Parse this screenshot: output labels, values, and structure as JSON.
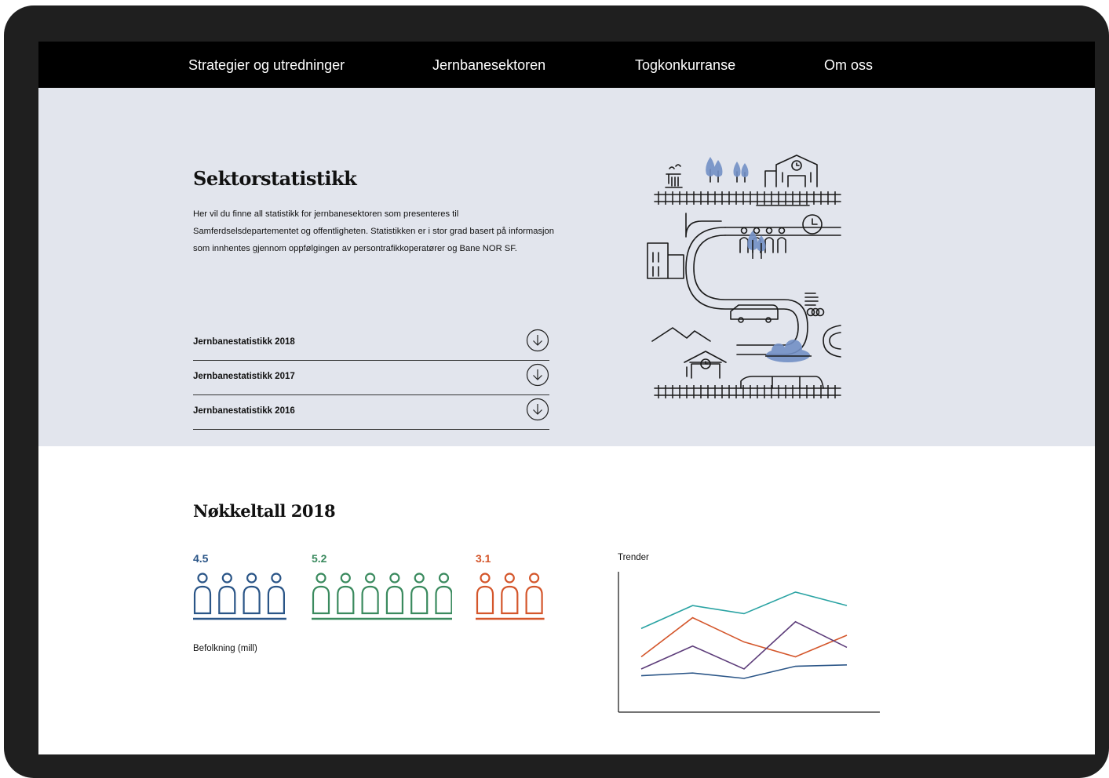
{
  "nav": {
    "items": [
      {
        "label": "Strategier og utredninger"
      },
      {
        "label": "Jernbanesektoren"
      },
      {
        "label": "Togkonkurranse"
      },
      {
        "label": "Om oss"
      }
    ]
  },
  "hero": {
    "title": "Sektorstatistikk",
    "text": "Her vil du finne all statistikk for jernbanesektoren som presenteres til Samferdselsdepartementet og offentligheten. Statistikken er i stor grad basert på informasjon som innhentes gjennom oppfølgingen av persontrafikkoperatører og Bane NOR SF.",
    "downloads": [
      {
        "label": "Jernbanestatistikk 2018",
        "icon": "download-circle-icon"
      },
      {
        "label": "Jernbanestatistikk 2017",
        "icon": "download-circle-icon"
      },
      {
        "label": "Jernbanestatistikk 2016",
        "icon": "download-circle-icon"
      }
    ]
  },
  "key_figures": {
    "title": "Nøkkeltall 2018",
    "stats": [
      {
        "value": "4.5",
        "people": 4,
        "color": "#2a5587"
      },
      {
        "value": "5.2",
        "people": 6,
        "color": "#3a8a5e"
      },
      {
        "value": "3.1",
        "people": 3,
        "color": "#d4562b"
      }
    ],
    "population_label": "Befolkning (mill)",
    "trend_label": "Trender"
  },
  "colors": {
    "nav_bg": "#000000",
    "hero_bg": "#e2e5ed",
    "illustration_accent": "#7390c6"
  },
  "chart_data": {
    "type": "line",
    "title": "Trender",
    "x": [
      1,
      2,
      3,
      4,
      5
    ],
    "xlabel": "",
    "ylabel": "",
    "ylim": [
      0,
      100
    ],
    "grid": false,
    "series": [
      {
        "color": "#2aa3a3",
        "values": [
          62,
          79,
          73,
          89,
          79
        ]
      },
      {
        "color": "#d4562b",
        "values": [
          41,
          70,
          52,
          41,
          57
        ]
      },
      {
        "color": "#5d3d7a",
        "values": [
          32,
          49,
          32,
          67,
          48
        ]
      },
      {
        "color": "#2a5587",
        "values": [
          27,
          29,
          25,
          34,
          35
        ]
      }
    ]
  }
}
